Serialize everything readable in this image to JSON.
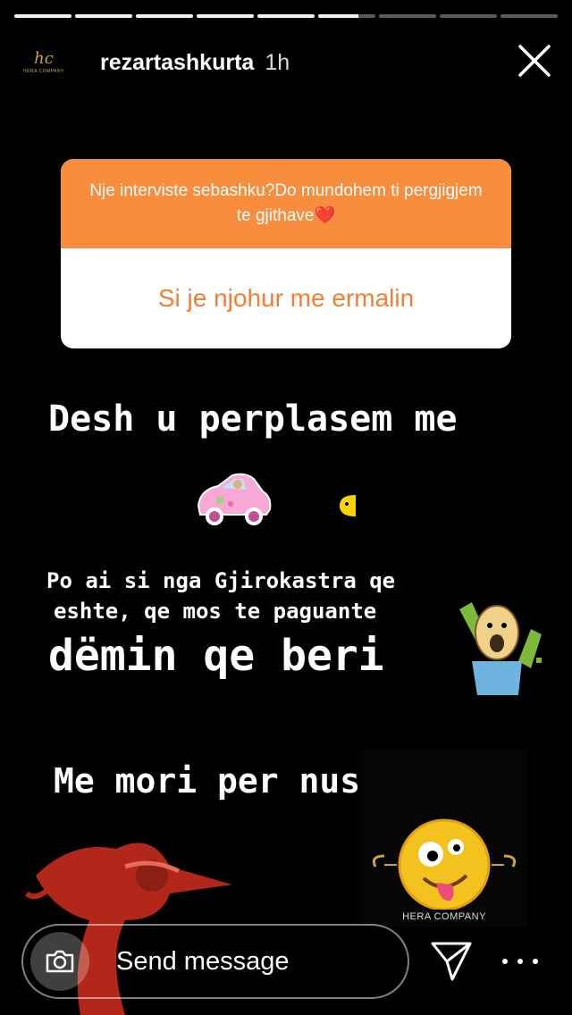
{
  "story": {
    "segments_total": 9,
    "segments_done": 5,
    "current_segment_progress": 0.7
  },
  "header": {
    "avatar_monogram": "hc",
    "avatar_subtitle": "HERA COMPANY",
    "username": "rezartashkurta",
    "time": "1h"
  },
  "question_sticker": {
    "prompt": "Nje interviste sebashku?Do mundohem ti pergjigjem te gjithave❤️",
    "answer": "Si je njohur me ermalin"
  },
  "story_text": {
    "line1": "Desh u perplasem me",
    "line2": "Po ai si nga Gjirokastra qe",
    "line3": "eshte, qe mos te paguante",
    "line4": "dëmin qe beri",
    "line5": "Me mori per nuse"
  },
  "watermark": {
    "brand": "HERA COMPANY"
  },
  "reply_bar": {
    "placeholder": "Send message"
  },
  "colors": {
    "question_header": "#f78d3d",
    "answer_text": "#f27e34",
    "background": "#000000"
  }
}
